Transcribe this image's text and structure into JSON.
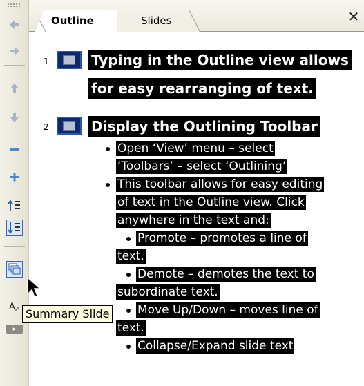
{
  "tabs": [
    {
      "label": "Outline"
    },
    {
      "label": "Slides"
    }
  ],
  "close_label": "✕",
  "tooltip": "Summary Slide",
  "slides": [
    {
      "number": "1",
      "title_lines": [
        "Typing in the Outline view allows",
        "for easy rearranging of text."
      ]
    },
    {
      "number": "2",
      "title_lines": [
        "Display the Outlining Toolbar"
      ],
      "bullets": [
        {
          "lines": [
            "Open ‘View’ menu – select",
            "‘Toolbars’ – select ‘Outlining’"
          ]
        },
        {
          "lines": [
            "This toolbar allows for easy editing",
            "of text in the Outline view.  Click",
            "anywhere in the text and:"
          ]
        },
        {
          "sub": true,
          "lines": [
            "Promote – promotes a line of",
            "text."
          ]
        },
        {
          "sub": true,
          "lines": [
            "Demote – demotes the text to",
            "subordinate text."
          ]
        },
        {
          "sub": true,
          "lines": [
            "Move Up/Down – moves line of",
            "text."
          ]
        },
        {
          "sub": true,
          "lines": [
            "Collapse/Expand slide text"
          ]
        }
      ]
    }
  ],
  "toolbar_icons": [
    "promote-arrow-icon",
    "demote-arrow-icon",
    "move-up-icon",
    "move-down-icon",
    "collapse-icon",
    "expand-icon",
    "collapse-all-icon",
    "expand-all-icon",
    "summary-slide-icon",
    "show-formatting-icon",
    "toolbar-options-icon"
  ],
  "colors": {
    "highlight": "#000000",
    "highlight_text": "#ffffff",
    "slide_icon": "#0a2a6c",
    "tooltip_bg": "#ffffe1"
  }
}
